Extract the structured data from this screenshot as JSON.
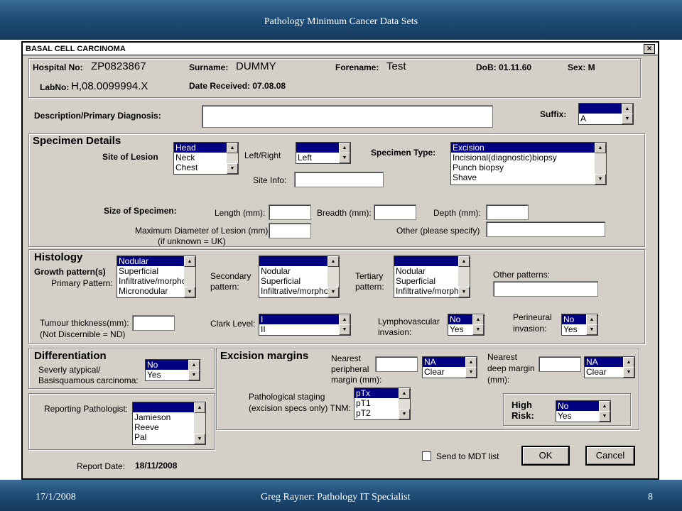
{
  "slide": {
    "header": "Pathology Minimum Cancer Data Sets",
    "date": "17/1/2008",
    "footer": "Greg Rayner:  Pathology IT Specialist",
    "page": "8"
  },
  "dialog": {
    "title": "BASAL CELL CARCINOMA",
    "close": "×"
  },
  "patient": {
    "hospital_label": "Hospital No:",
    "hospital_value": "ZP0823867",
    "surname_label": "Surname:",
    "surname_value": "DUMMY",
    "forename_label": "Forename:",
    "forename_value": "Test",
    "dob": "DoB:  01.11.60",
    "sex": "Sex: M",
    "labno_label": "LabNo:",
    "labno_value": "H,08.0099994.X",
    "date_received": "Date Received:  07.08.08"
  },
  "diagnosis": {
    "label": "Description/Primary Diagnosis:",
    "value": "",
    "suffix_label": "Suffix:",
    "suffix_options": [
      "",
      "A"
    ]
  },
  "specimen": {
    "section_title": "Specimen Details",
    "site_label": "Site of Lesion",
    "site_options": [
      "Head",
      "Neck",
      "Chest"
    ],
    "leftright_label": "Left/Right",
    "leftright_options": [
      "",
      "Left"
    ],
    "type_label": "Specimen Type:",
    "type_options": [
      "Excision",
      "Incisional(diagnostic)biopsy",
      "Punch biopsy",
      "Shave"
    ],
    "siteinfo_label": "Site Info:",
    "size_label": "Size of Specimen:",
    "length_label": "Length (mm):",
    "breadth_label": "Breadth (mm):",
    "depth_label": "Depth (mm):",
    "maxdiam_label1": "Maximum Diameter of Lesion (mm):",
    "maxdiam_label2": "(if unknown = UK)",
    "other_label": "Other (please specify)"
  },
  "histology": {
    "section_title": "Histology",
    "growth_label": "Growth pattern(s)",
    "primary_label": "Primary Pattern:",
    "primary_options": [
      "Nodular",
      "Superficial",
      "Infiltrative/morphoeic",
      "Micronodular"
    ],
    "secondary_label1": "Secondary",
    "secondary_label2": "pattern:",
    "secondary_options": [
      "",
      "Nodular",
      "Superficial",
      "Infiltrative/morphoeic"
    ],
    "tertiary_label1": "Tertiary",
    "tertiary_label2": "pattern:",
    "tertiary_options": [
      "",
      "Nodular",
      "Superficial",
      "Infiltrative/morphoeic"
    ],
    "other_label": "Other patterns:",
    "thickness_label1": "Tumour thickness(mm):",
    "thickness_label2": "(Not Discernible = ND)",
    "clark_label": "Clark Level:",
    "clark_options": [
      "I",
      "II"
    ],
    "lymph_label1": "Lymphovascular",
    "lymph_label2": "invasion:",
    "lymph_options": [
      "No",
      "Yes"
    ],
    "perineural_label1": "Perineural",
    "perineural_label2": "invasion:",
    "perineural_options": [
      "No",
      "Yes"
    ]
  },
  "differentiation": {
    "section_title": "Differentiation",
    "label1": "Severly atypical/",
    "label2": "Basisquamous carcinoma:",
    "options": [
      "No",
      "Yes"
    ]
  },
  "excision": {
    "section_title": "Excision margins",
    "peripheral_label1": "Nearest",
    "peripheral_label2": "peripheral",
    "peripheral_label3": "margin (mm):",
    "peripheral_options": [
      "NA",
      "Clear"
    ],
    "deep_label1": "Nearest",
    "deep_label2": "deep margin",
    "deep_label3": "(mm):",
    "deep_options": [
      "NA",
      "Clear"
    ],
    "staging_label1": "Pathological staging",
    "staging_label2": "(excision specs only) TNM:",
    "staging_options": [
      "pTx",
      "pT1",
      "pT2"
    ],
    "risk_label1": "High",
    "risk_label2": "Risk:",
    "risk_options": [
      "No",
      "Yes"
    ]
  },
  "reporting": {
    "pathologist_label": "Reporting Pathologist:",
    "pathologist_options": [
      "",
      "Jamieson",
      "Reeve",
      "Pal"
    ],
    "date_label": "Report Date:",
    "date_value": "18/11/2008",
    "mdt_label": "Send to MDT list",
    "ok": "OK",
    "cancel": "Cancel"
  }
}
